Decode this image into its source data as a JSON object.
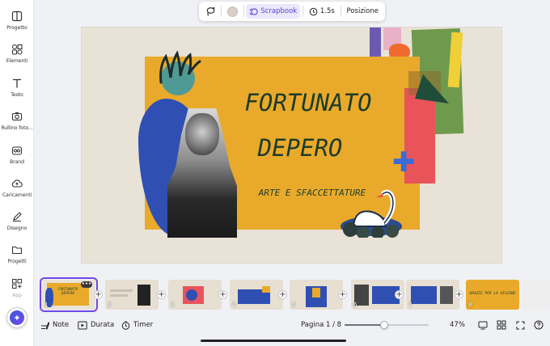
{
  "sidebar": {
    "items": [
      {
        "label": "Progetto",
        "icon": "layout-icon"
      },
      {
        "label": "Elementi",
        "icon": "elements-icon"
      },
      {
        "label": "Testo",
        "icon": "text-icon"
      },
      {
        "label": "Rullino foto...",
        "icon": "camera-icon"
      },
      {
        "label": "Brand",
        "icon": "brand-icon"
      },
      {
        "label": "Caricamenti",
        "icon": "upload-icon"
      },
      {
        "label": "Disegno",
        "icon": "draw-icon"
      },
      {
        "label": "Progetti",
        "icon": "folder-icon"
      },
      {
        "label": "App",
        "icon": "apps-icon"
      }
    ],
    "magic_button_icon": "sparkle-icon"
  },
  "toolbar": {
    "swatch_color": "#d8d0c6",
    "scrapbook_label": "Scrapbook",
    "duration_label": "1.5s",
    "position_label": "Posizione"
  },
  "slide": {
    "title_line1": "FORTUNATO",
    "title_line2": "DEPERO",
    "subtitle": "ARTE E SFACCETTATURE"
  },
  "filmstrip": {
    "pages": [
      {
        "num": "1",
        "text": "FORTUNATO DEPERO",
        "selected": true
      },
      {
        "num": "2",
        "text": ""
      },
      {
        "num": "3",
        "text": ""
      },
      {
        "num": "4",
        "text": ""
      },
      {
        "num": "5",
        "text": ""
      },
      {
        "num": "6",
        "text": ""
      },
      {
        "num": "7",
        "text": ""
      },
      {
        "num": "8",
        "text": "GRAZIE PER LA VISIONE"
      }
    ],
    "more_label": "•••"
  },
  "bottombar": {
    "notes_label": "Note",
    "duration_label": "Durata",
    "timer_label": "Timer",
    "page_label": "Pagina 1 / 8",
    "zoom_label": "47%",
    "zoom_value": 47
  },
  "colors": {
    "accent": "#7048e8",
    "slide_yellow": "#e9aa2b",
    "slide_bg": "#e9e2d6",
    "title_green": "#1e3b2a"
  }
}
